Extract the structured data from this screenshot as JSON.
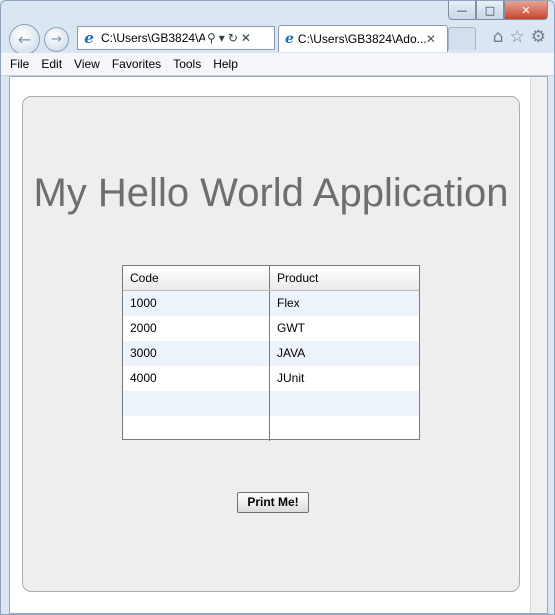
{
  "browser": {
    "address_text": "C:\\Users\\GB3824\\A",
    "tab_title": "C:\\Users\\GB3824\\Ado...",
    "menu": [
      "File",
      "Edit",
      "View",
      "Favorites",
      "Tools",
      "Help"
    ]
  },
  "app": {
    "heading": "My Hello World Application",
    "table": {
      "headers": [
        "Code",
        "Product"
      ],
      "rows": [
        [
          "1000",
          "Flex"
        ],
        [
          "2000",
          "GWT"
        ],
        [
          "3000",
          "JAVA"
        ],
        [
          "4000",
          "JUnit"
        ],
        [
          "",
          ""
        ],
        [
          "",
          ""
        ]
      ]
    },
    "print_button": "Print Me!"
  }
}
